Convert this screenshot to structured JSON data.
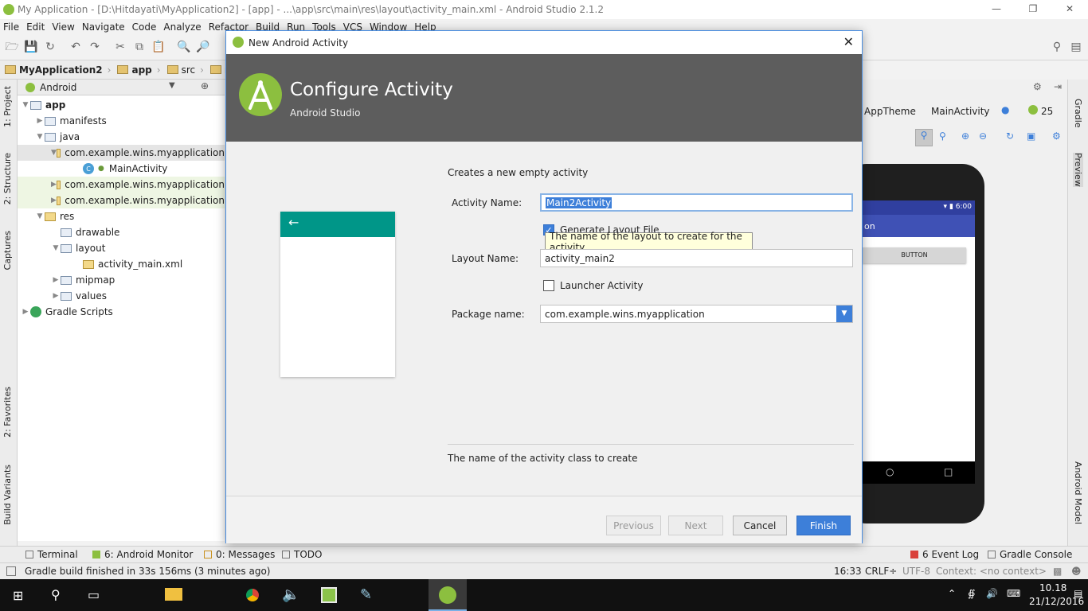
{
  "window": {
    "title": "My Application - [D:\\Hitdayati\\MyApplication2] - [app] - ...\\app\\src\\main\\res\\layout\\activity_main.xml - Android Studio 2.1.2"
  },
  "menu": [
    "File",
    "Edit",
    "View",
    "Navigate",
    "Code",
    "Analyze",
    "Refactor",
    "Build",
    "Run",
    "Tools",
    "VCS",
    "Window",
    "Help"
  ],
  "breadcrumbs": [
    "MyApplication2",
    "app",
    "src",
    "main"
  ],
  "project_view": {
    "selector": "Android"
  },
  "tree": [
    {
      "label": "app",
      "level": 0,
      "expanded": true
    },
    {
      "label": "manifests",
      "level": 1,
      "expanded": false
    },
    {
      "label": "java",
      "level": 1,
      "expanded": true
    },
    {
      "label": "com.example.wins.myapplication",
      "level": 2,
      "expanded": true
    },
    {
      "label": "MainActivity",
      "level": 3
    },
    {
      "label": "com.example.wins.myapplication",
      "level": 2,
      "expanded": false
    },
    {
      "label": "com.example.wins.myapplication",
      "level": 2,
      "expanded": false
    },
    {
      "label": "res",
      "level": 1,
      "expanded": true
    },
    {
      "label": "drawable",
      "level": 2
    },
    {
      "label": "layout",
      "level": 2,
      "expanded": true
    },
    {
      "label": "activity_main.xml",
      "level": 3
    },
    {
      "label": "mipmap",
      "level": 2,
      "expanded": false
    },
    {
      "label": "values",
      "level": 2,
      "expanded": false
    },
    {
      "label": "Gradle Scripts",
      "level": 0,
      "expanded": false
    }
  ],
  "left_tabs": [
    "1: Project",
    "2: Structure",
    "Captures",
    "2: Favorites",
    "Build Variants"
  ],
  "right_tabs": [
    "Gradle",
    "Preview",
    "Android Model"
  ],
  "editor_toolbar": {
    "theme": "AppTheme",
    "activity": "MainActivity",
    "api": "25"
  },
  "phone": {
    "time": "6:00",
    "app_title_fragment": "on",
    "button": "BUTTON"
  },
  "dialog": {
    "title": "New Android Activity",
    "heading": "Configure Activity",
    "subheading": "Android Studio",
    "description": "Creates a new empty activity",
    "activity_name_label": "Activity Name:",
    "activity_name_value": "Main2Activity",
    "generate_layout_label": "Generate Layout File",
    "tooltip": "The name of the layout to create for the activity",
    "layout_name_label": "Layout Name:",
    "layout_name_value": "activity_main2",
    "launcher_label": "Launcher Activity",
    "package_label": "Package name:",
    "package_value": "com.example.wins.myapplication",
    "hint": "The name of the activity class to create",
    "buttons": {
      "previous": "Previous",
      "next": "Next",
      "cancel": "Cancel",
      "finish": "Finish"
    }
  },
  "bottom_tabs": {
    "terminal": "Terminal",
    "monitor": "6: Android Monitor",
    "messages": "0: Messages",
    "todo": "TODO",
    "eventlog": "6 Event Log",
    "console": "Gradle Console"
  },
  "status": {
    "message": "Gradle build finished in 33s 156ms (3 minutes ago)",
    "position": "16:33",
    "line_sep": "CRLF÷",
    "encoding": "UTF-8",
    "context": "Context: <no context>"
  },
  "taskbar": {
    "time": "10.18",
    "date": "21/12/2016"
  },
  "colors": {
    "accent": "#3d7fd9",
    "header": "#5d5d5d",
    "teal": "#009688",
    "android_green": "#8cbf3f"
  }
}
